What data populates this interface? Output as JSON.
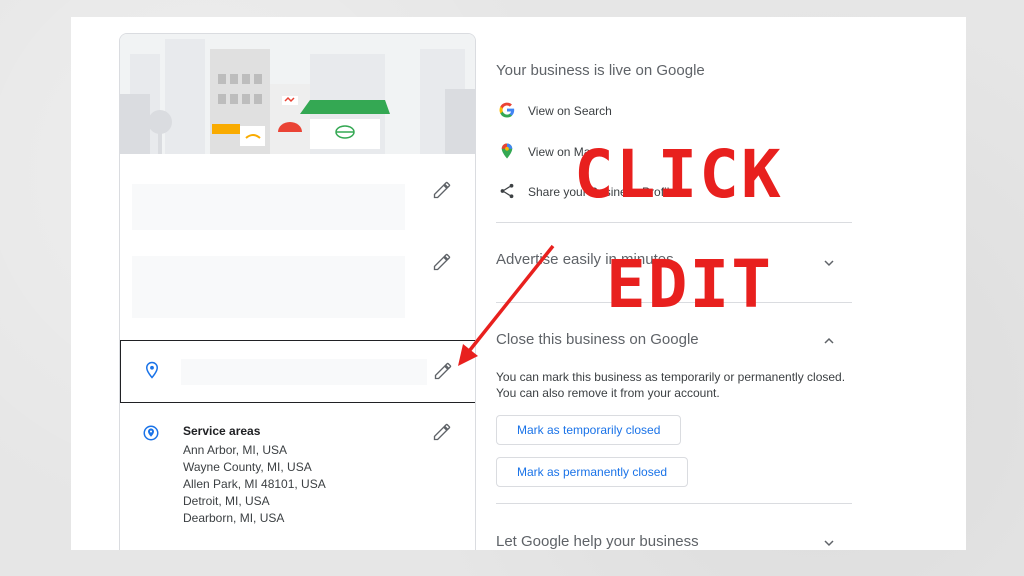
{
  "left": {
    "service_areas": {
      "title": "Service areas",
      "items": [
        "Ann Arbor, MI, USA",
        "Wayne County, MI, USA",
        "Allen Park, MI 48101, USA",
        "Detroit, MI, USA",
        "Dearborn, MI, USA"
      ]
    }
  },
  "right": {
    "live_title": "Your business is live on Google",
    "links": [
      {
        "label": "View on Search",
        "icon": "google-g-icon"
      },
      {
        "label": "View on Maps",
        "icon": "maps-pin-icon"
      },
      {
        "label": "Share your Business Profile",
        "icon": "share-icon"
      }
    ],
    "advertise_title": "Advertise easily in minutes",
    "close_title": "Close this business on Google",
    "close_desc": "You can mark this business as temporarily or permanently closed. You can also remove it from your account.",
    "btn_temp": "Mark as temporarily closed",
    "btn_perm": "Mark as permanently closed",
    "help_title": "Let Google help your business"
  },
  "overlay": {
    "line1": "CLICK",
    "line2": "EDIT"
  },
  "colors": {
    "annotation_red": "#e8201e",
    "link_blue": "#1a73e8",
    "pin_blue": "#1a73e8"
  }
}
